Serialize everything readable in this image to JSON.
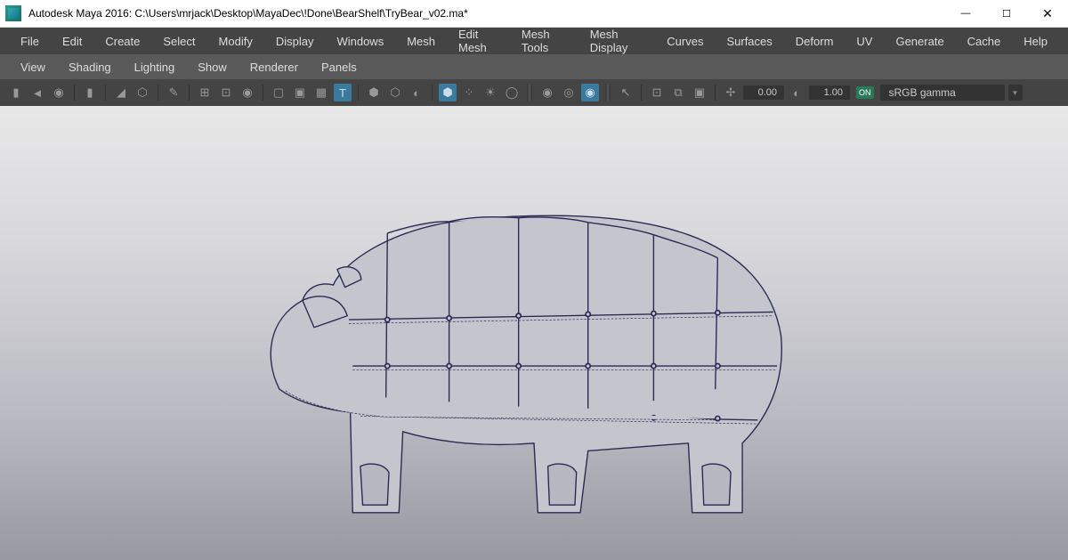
{
  "window": {
    "title": "Autodesk Maya 2016: C:\\Users\\mrjack\\Desktop\\MayaDec\\!Done\\BearShelf\\TryBear_v02.ma*",
    "min": "—",
    "max": "☐",
    "close": "✕"
  },
  "menu": {
    "items": [
      "File",
      "Edit",
      "Create",
      "Select",
      "Modify",
      "Display",
      "Windows",
      "Mesh",
      "Edit Mesh",
      "Mesh Tools",
      "Mesh Display",
      "Curves",
      "Surfaces",
      "Deform",
      "UV",
      "Generate",
      "Cache",
      "Help"
    ]
  },
  "panel": {
    "items": [
      "View",
      "Shading",
      "Lighting",
      "Show",
      "Renderer",
      "Panels"
    ]
  },
  "toolbar": {
    "val1": "0.00",
    "val2": "1.00",
    "on": "ON",
    "colorspace": "sRGB gamma",
    "dd": "▼"
  }
}
